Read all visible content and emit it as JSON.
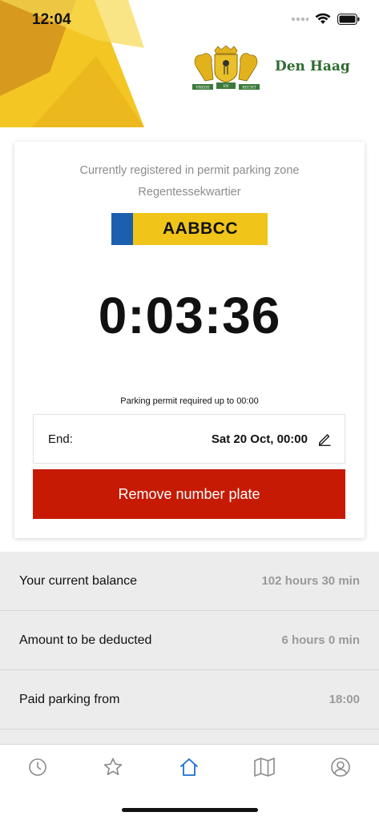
{
  "status_bar": {
    "time": "12:04"
  },
  "header": {
    "city_name": "Den Haag",
    "motto_words": [
      "VREDE",
      "EN",
      "RECHT"
    ]
  },
  "permit": {
    "zone_line1": "Currently registered in permit parking zone",
    "zone_line2": "Regentessekwartier",
    "plate": "AABBCC",
    "timer": "0:03:36",
    "required_note": "Parking permit required up to 00:00",
    "end_label": "End:",
    "end_value": "Sat 20 Oct, 00:00",
    "remove_label": "Remove number plate"
  },
  "info_rows": [
    {
      "label": "Your current balance",
      "value": "102 hours 30 min"
    },
    {
      "label": "Amount to be deducted",
      "value": "6 hours 0 min"
    },
    {
      "label": "Paid parking from",
      "value": "18:00"
    }
  ],
  "tabbar": {
    "tabs": [
      {
        "icon": "clock-icon",
        "active": false
      },
      {
        "icon": "star-icon",
        "active": false
      },
      {
        "icon": "home-icon",
        "active": true
      },
      {
        "icon": "map-icon",
        "active": false
      },
      {
        "icon": "profile-icon",
        "active": false
      }
    ]
  },
  "colors": {
    "accent_yellow": "#f0c419",
    "danger_red": "#c61a04",
    "active_tab_blue": "#1a6fd1",
    "brand_green": "#2f6b2f",
    "plate_blue": "#1b5fae"
  }
}
